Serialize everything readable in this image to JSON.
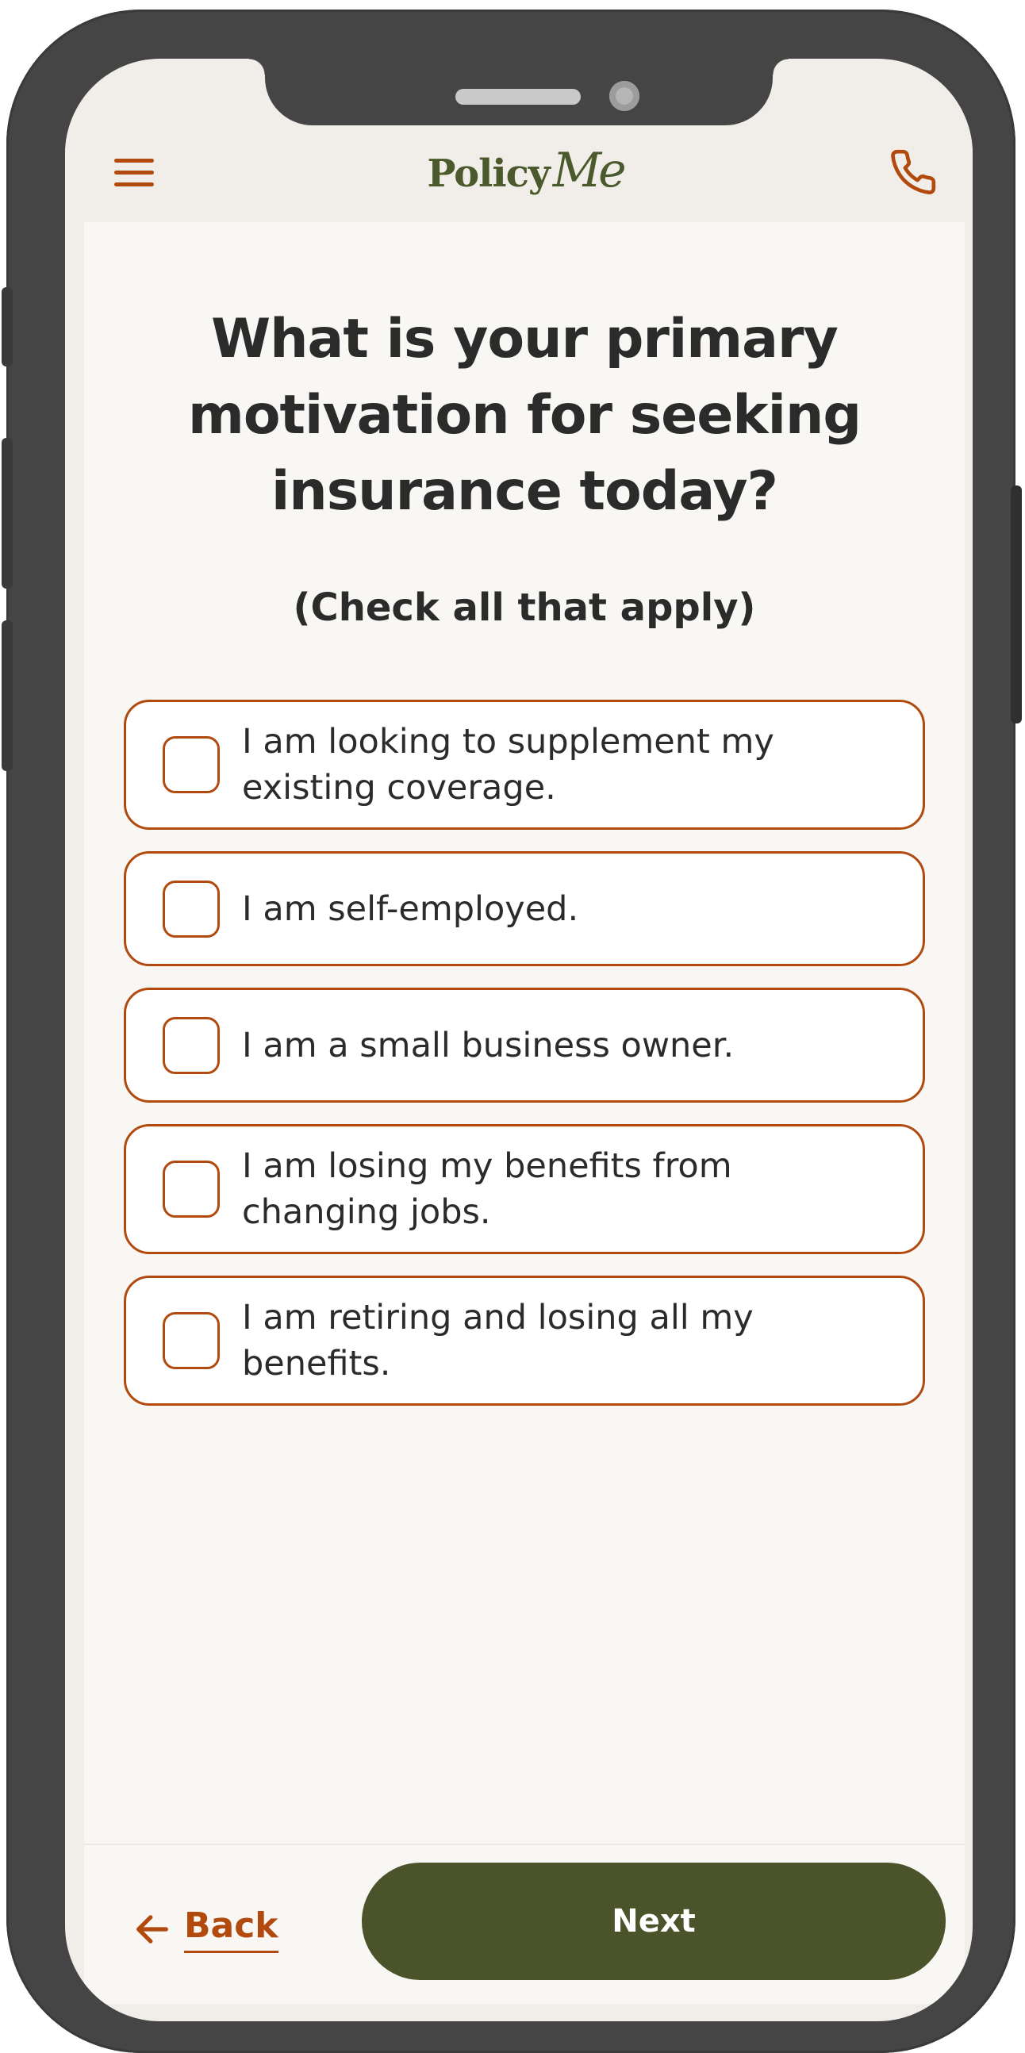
{
  "header": {
    "logo_policy": "Policy",
    "logo_me": "Me",
    "menu_icon": "hamburger-menu-icon",
    "phone_icon": "phone-icon"
  },
  "question": {
    "title": "What is your primary motivation for seeking insurance today?",
    "subtitle": "(Check all that apply)"
  },
  "options": [
    {
      "label": "I am looking to supplement my existing coverage.",
      "checked": false
    },
    {
      "label": "I am self-employed.",
      "checked": false
    },
    {
      "label": "I am a small business owner.",
      "checked": false
    },
    {
      "label": "I am losing my benefits from changing jobs.",
      "checked": false
    },
    {
      "label": "I am retiring and losing all my benefits.",
      "checked": false
    }
  ],
  "footer": {
    "back_label": "Back",
    "next_label": "Next"
  },
  "colors": {
    "accent": "#b24a0f",
    "brand_green": "#4a532a",
    "text": "#2b2b2b",
    "background": "#f9f7f4"
  }
}
